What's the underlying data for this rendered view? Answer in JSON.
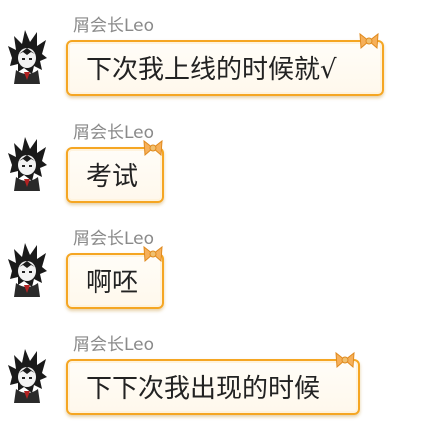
{
  "messages": [
    {
      "sender": "屑会长Leo",
      "text": "下次我上线的时候就√"
    },
    {
      "sender": "屑会长Leo",
      "text": "考试"
    },
    {
      "sender": "屑会长Leo",
      "text": "啊呸"
    },
    {
      "sender": "屑会长Leo",
      "text": "下下次我出现的时候"
    }
  ],
  "colors": {
    "bubble_border": "#f5a623",
    "sender_text": "#8a8a8a",
    "message_text": "#222222"
  },
  "icons": {
    "avatar": "avatar-icon",
    "bubble_decoration": "bow-icon"
  }
}
